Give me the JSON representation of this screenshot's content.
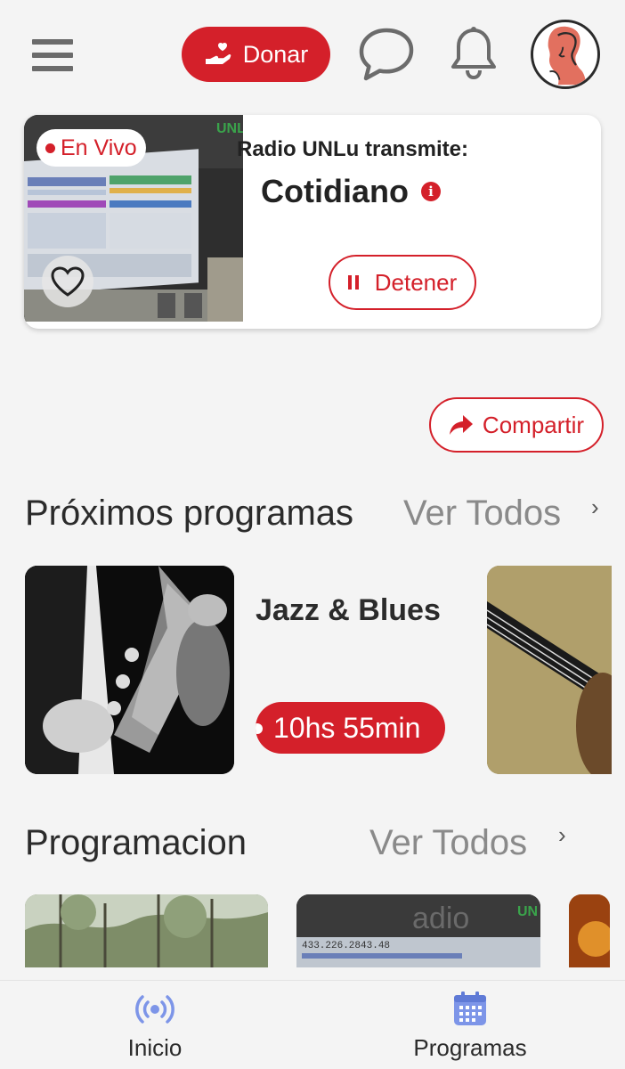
{
  "colors": {
    "accent": "#d4202a",
    "nav_icon": "#7d95e8",
    "text": "#2b2b2b",
    "muted": "#8a8a8a"
  },
  "header": {
    "menu_icon": "hamburger-menu-icon",
    "donate_label": "Donar",
    "donate_icon": "hand-heart-icon",
    "chat_icon": "chat-bubble-icon",
    "bell_icon": "bell-icon",
    "avatar_icon": "user-avatar"
  },
  "live": {
    "badge": "En Vivo",
    "transmits_label": "Radio UNLu transmite:",
    "program": "Cotidiano",
    "stop_label": "Detener",
    "favorite_icon": "heart-icon",
    "info_icon": "info-icon",
    "pause_icon": "pause-icon",
    "thumb_brand": "UNL"
  },
  "share": {
    "label": "Compartir",
    "icon": "share-arrow-icon"
  },
  "upcoming": {
    "title": "Próximos programas",
    "see_all": "Ver Todos",
    "items": [
      {
        "title": "Jazz & Blues",
        "time": "10hs 55min"
      }
    ]
  },
  "schedule": {
    "title": "Programacion",
    "see_all": "Ver Todos",
    "thumb_brand": "UN",
    "thumb_caption": "433.226.2843.48",
    "thumb_word": "adio"
  },
  "nav": {
    "items": [
      {
        "label": "Inicio",
        "icon": "radio-broadcast-icon"
      },
      {
        "label": "Programas",
        "icon": "calendar-icon"
      }
    ]
  }
}
